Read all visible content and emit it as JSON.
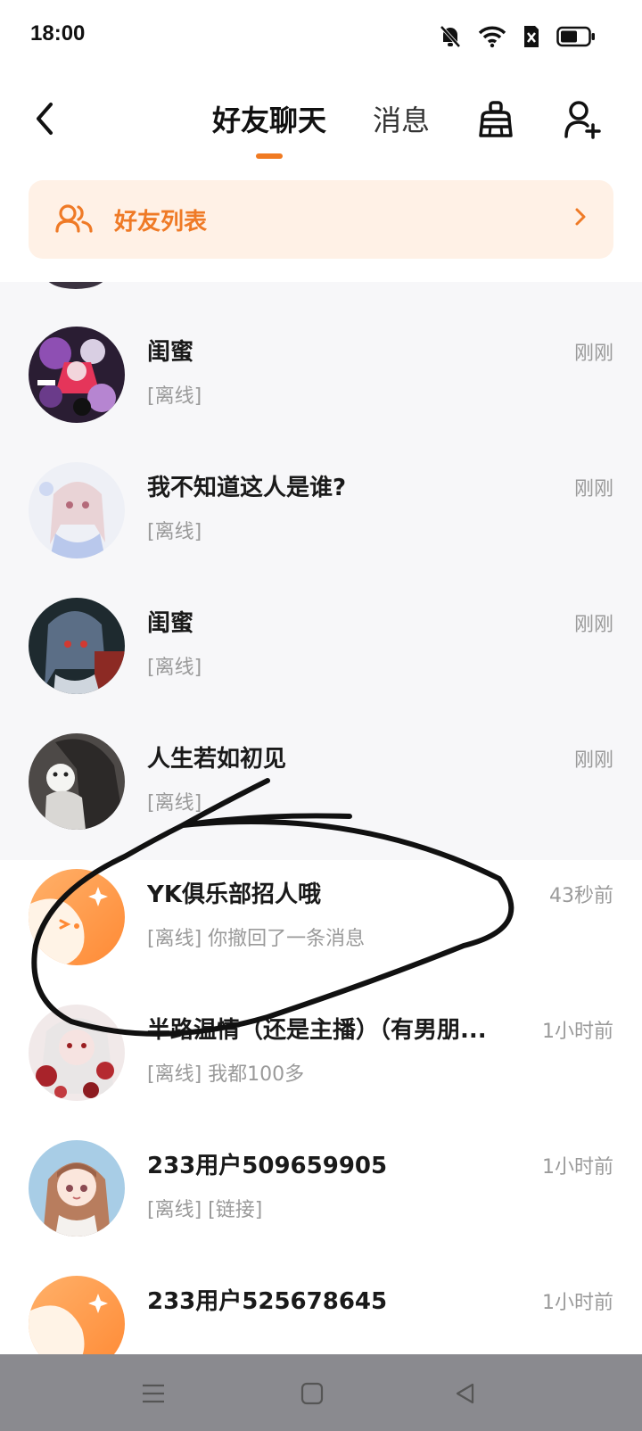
{
  "status_bar": {
    "time": "18:00",
    "icons": [
      "bell-muted-icon",
      "wifi-icon",
      "sim-blocked-icon",
      "battery-icon"
    ]
  },
  "header": {
    "tabs": [
      {
        "label": "好友聊天",
        "active": true
      },
      {
        "label": "消息",
        "active": false
      }
    ],
    "accent_color": "#f07a22"
  },
  "friend_list_banner": {
    "label": "好友列表",
    "background": "#fff1e6",
    "text_color": "#ef7a26"
  },
  "chats": [
    {
      "name": "闺蜜",
      "message": "[离线]",
      "time": "刚刚",
      "avatar": "anime-avatar-purple"
    },
    {
      "name": "我不知道这人是谁?",
      "message": "[离线]",
      "time": "刚刚",
      "avatar": "anime-avatar-pastel"
    },
    {
      "name": "闺蜜",
      "message": "[离线]",
      "time": "刚刚",
      "avatar": "anime-avatar-dark"
    },
    {
      "name": "人生若如初见",
      "message": "[离线]",
      "time": "刚刚",
      "avatar": "photo-avatar-gray"
    },
    {
      "name": "YK俱乐部招人哦",
      "message": "[离线] 你撤回了一条消息",
      "time": "43秒前",
      "avatar": "default-orange-avatar"
    },
    {
      "name": "半路温情（还是主播）（有男朋...",
      "message": "[离线] 我都100多",
      "time": "1小时前",
      "avatar": "anime-avatar-red"
    },
    {
      "name": "233用户509659905",
      "message": "[离线] [链接]",
      "time": "1小时前",
      "avatar": "anime-avatar-girl"
    },
    {
      "name": "233用户525678645",
      "message": "",
      "time": "1小时前",
      "avatar": "default-orange-avatar"
    }
  ]
}
